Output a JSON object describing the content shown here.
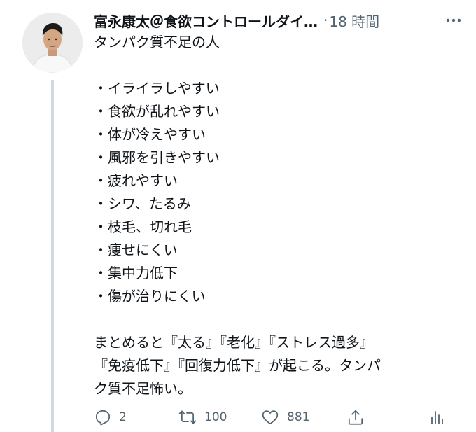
{
  "tweet": {
    "author": {
      "name": "富永康太＠食欲コントロールダイ…"
    },
    "separator": "·",
    "timestamp": "18 時間",
    "more_icon": "more-dots-icon",
    "text": {
      "title": "タンパク質不足の人",
      "items": [
        "・イライラしやすい",
        "・食欲が乱れやすい",
        "・体が冷えやすい",
        "・風邪を引きやすい",
        "・疲れやすい",
        "・シワ、たるみ",
        "・枝毛、切れ毛",
        "・痩せにくい",
        "・集中力低下",
        "・傷が治りにくい"
      ],
      "summary_lines": [
        "まとめると『太る』『老化』『ストレス過多』",
        "『免疫低下』『回復力低下』が起こる。タンパ",
        "ク質不足怖い。"
      ]
    },
    "actions": {
      "reply_count": "2",
      "retweet_count": "100",
      "like_count": "881"
    }
  },
  "colors": {
    "text": "#0f1419",
    "secondary": "#536471",
    "thread_line": "#cfd9de",
    "background": "#ffffff"
  }
}
